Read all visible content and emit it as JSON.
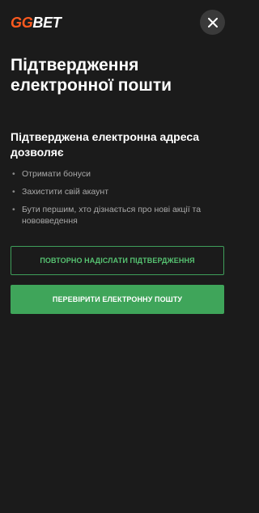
{
  "header": {
    "logo_part1": "GG",
    "logo_part2": "BET",
    "close_label": "close"
  },
  "content": {
    "title": "Підтвердження електронної пошти",
    "subtitle": "Підтверджена електронна адреса дозволяє",
    "benefits": [
      {
        "bullet": "•",
        "text": "Отримати бонуси"
      },
      {
        "bullet": "•",
        "text": "Захистити свій акаунт"
      },
      {
        "bullet": "•",
        "text": "Бути першим, хто дізнається про нові акції та нововведення"
      }
    ]
  },
  "actions": {
    "resend_label": "ПОВТОРНО НАДІСЛАТИ ПІДТВЕРДЖЕННЯ",
    "check_label": "ПЕРЕВІРИТИ ЕЛЕКТРОННУ ПОШТУ"
  },
  "colors": {
    "background": "#1b1b1b",
    "brand_orange": "#ff5a1f",
    "accent_green": "#3fa55a"
  }
}
